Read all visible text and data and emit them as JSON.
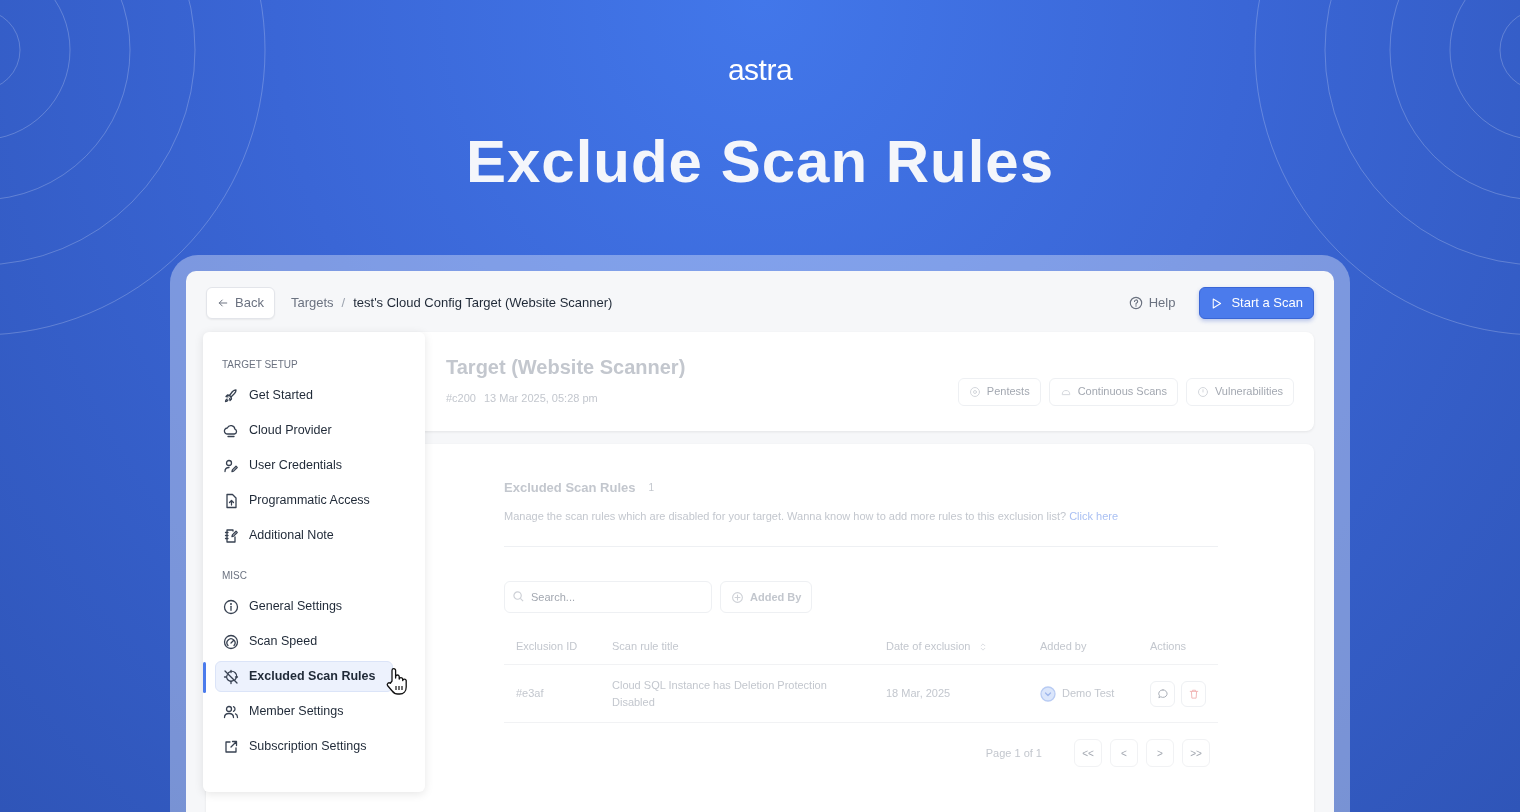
{
  "logo": "astra",
  "headline": "Exclude Scan Rules",
  "header": {
    "back": "Back",
    "breadcrumbs": [
      {
        "label": "Targets"
      },
      {
        "label": "test's Cloud Config Target (Website Scanner)"
      }
    ],
    "separator": "/",
    "help": "Help",
    "start_button": "Start a Scan"
  },
  "target_card": {
    "title": "Target (Website Scanner)",
    "meta": [
      "#c200",
      "13 Mar 2025, 05:28 pm"
    ],
    "tabs": [
      "Pentests",
      "Continuous Scans",
      "Vulnerabilities"
    ]
  },
  "sidebar": {
    "sections": [
      {
        "title": "TARGET SETUP",
        "items": [
          {
            "label": "Get Started",
            "selected": false
          },
          {
            "label": "Cloud Provider",
            "selected": false
          },
          {
            "label": "User Credentials",
            "selected": false
          },
          {
            "label": "Programmatic Access",
            "selected": false
          },
          {
            "label": "Additional Note",
            "selected": false
          }
        ]
      },
      {
        "title": "MISC",
        "items": [
          {
            "label": "General Settings",
            "selected": false
          },
          {
            "label": "Scan Speed",
            "selected": false
          },
          {
            "label": "Excluded Scan Rules",
            "selected": true
          },
          {
            "label": "Member Settings",
            "selected": false
          },
          {
            "label": "Subscription Settings",
            "selected": false
          }
        ]
      }
    ]
  },
  "rules": {
    "title": "Excluded Scan Rules",
    "count": "1",
    "description": "Manage the scan rules which are disabled for your target. Wanna know how to add more rules to this exclusion list?",
    "link": "Click here",
    "search": {
      "placeholder": "Search..."
    },
    "filter": "Added By",
    "columns": [
      "Exclusion ID",
      "Scan rule title",
      "Date of exclusion",
      "Added by",
      "Actions"
    ],
    "rows": [
      {
        "id": "#e3af",
        "title": "Cloud SQL Instance has Deletion Protection Disabled",
        "date": "18 Mar, 2025",
        "added_by": "Demo Test"
      }
    ],
    "pagination": "Page 1 of 1",
    "page_buttons": [
      "<<",
      "<",
      ">",
      ">>"
    ]
  }
}
